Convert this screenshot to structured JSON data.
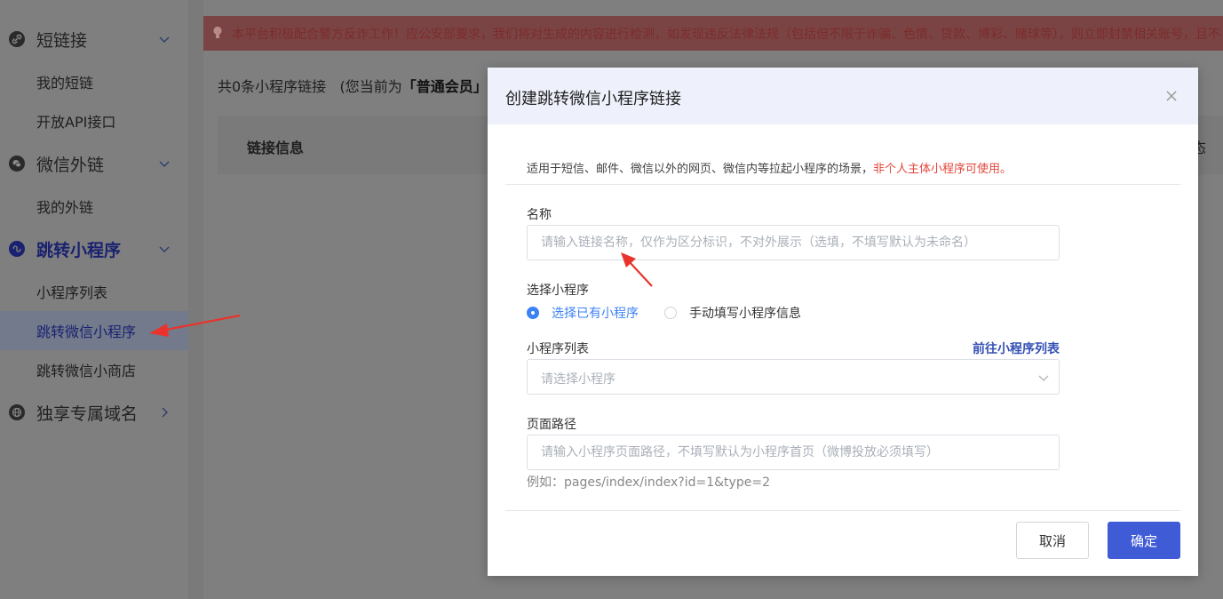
{
  "sidebar": {
    "groups": [
      {
        "label": "短链接",
        "icon": "link-icon"
      },
      {
        "label": "微信外链",
        "icon": "wechat-icon"
      },
      {
        "label": "跳转小程序",
        "icon": "miniprogram-icon"
      },
      {
        "label": "独享专属域名",
        "icon": "globe-icon"
      }
    ],
    "items": [
      {
        "label": "我的短链"
      },
      {
        "label": "开放API接口"
      },
      {
        "label": "我的外链"
      },
      {
        "label": "小程序列表"
      },
      {
        "label": "跳转微信小程序"
      },
      {
        "label": "跳转微信小商店"
      }
    ]
  },
  "notice": {
    "text": "本平台积极配合警方反诈工作！应公安部要求，我们将对生成的内容进行检测，如发现违反法律法规（包括但不限于诈骗、色情、贷款、博彩、赌球等），则立即封禁相关账号，且不"
  },
  "summary": {
    "prefix": "共0条小程序链接",
    "member_prefix": "(您当前为",
    "member_level": "「普通会员」"
  },
  "table": {
    "col_link_info": "链接信息",
    "col_status_partial": "态"
  },
  "modal": {
    "title": "创建跳转微信小程序链接",
    "description": "适用于短信、邮件、微信以外的网页、微信内等拉起小程序的场景，",
    "description_warning": "非个人主体小程序可使用。",
    "name_label": "名称",
    "name_placeholder": "请输入链接名称，仅作为区分标识，不对外展示（选填，不填写默认为未命名）",
    "select_label": "选择小程序",
    "radio_existing": "选择已有小程序",
    "radio_manual": "手动填写小程序信息",
    "list_label": "小程序列表",
    "list_link": "前往小程序列表",
    "list_placeholder": "请选择小程序",
    "path_label": "页面路径",
    "path_placeholder": "请输入小程序页面路径，不填写默认为小程序首页（微博投放必须填写）",
    "path_hint": "例如：pages/index/index?id=1&type=2",
    "cancel_label": "取消",
    "confirm_label": "确定"
  },
  "colors": {
    "primary": "#3f5bd6",
    "radio_active": "#3c82f6",
    "warning_text": "#e4463b",
    "annotation_arrow": "#e8342c",
    "modal_header_bg": "#eef1fb"
  }
}
